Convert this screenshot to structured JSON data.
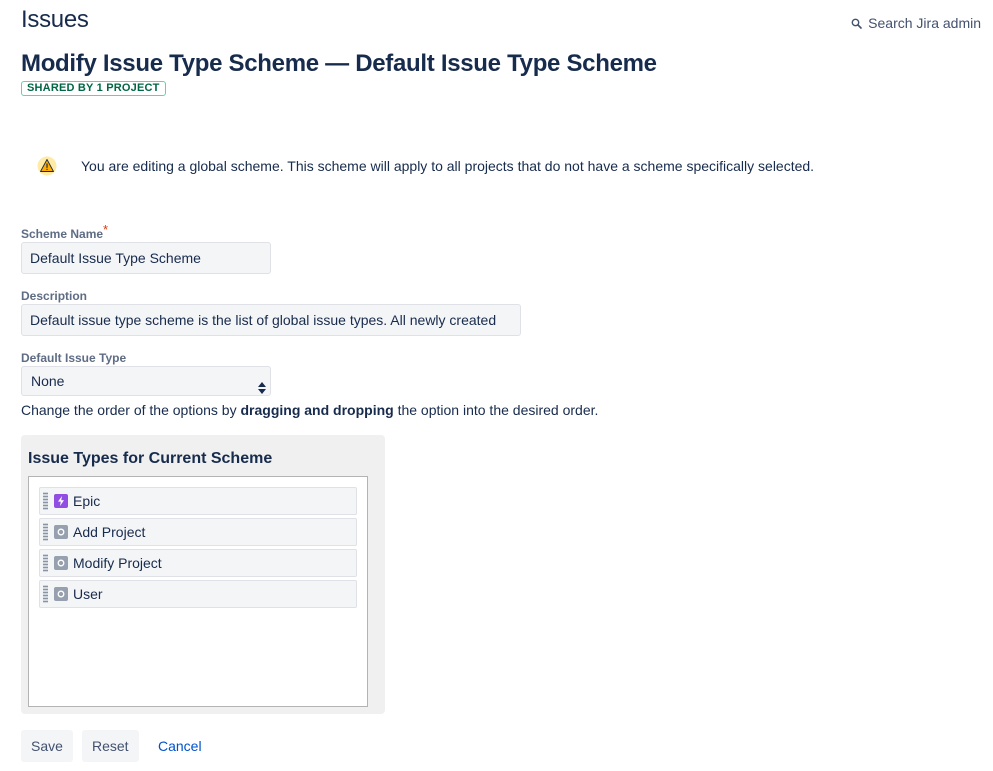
{
  "header": {
    "title": "Issues",
    "search_label": "Search Jira admin"
  },
  "scheme": {
    "title": "Modify Issue Type Scheme — Default Issue Type Scheme",
    "badge": "SHARED BY 1 PROJECT"
  },
  "warning": {
    "icon": "warning-icon",
    "text": "You are editing a global scheme. This scheme will apply to all projects that do not have a scheme specifically selected."
  },
  "form": {
    "name_label": "Scheme Name",
    "required_mark": "*",
    "name_value": "Default Issue Type Scheme",
    "description_label": "Description",
    "description_value": "Default issue type scheme is the list of global issue types. All newly created",
    "default_type_label": "Default Issue Type",
    "default_type_value": "None",
    "hint_prefix": "Change the order of the options by ",
    "hint_bold": "dragging and dropping",
    "hint_suffix": " the option into the desired order."
  },
  "panel": {
    "title": "Issue Types for Current Scheme",
    "items": [
      {
        "label": "Epic",
        "icon": "epic-icon",
        "color": "#904ee2"
      },
      {
        "label": "Add Project",
        "icon": "issue-type-icon",
        "color": "#97a0af"
      },
      {
        "label": "Modify Project",
        "icon": "issue-type-icon",
        "color": "#97a0af"
      },
      {
        "label": "User",
        "icon": "issue-type-icon",
        "color": "#97a0af"
      }
    ]
  },
  "actions": {
    "save": "Save",
    "reset": "Reset",
    "cancel": "Cancel"
  }
}
